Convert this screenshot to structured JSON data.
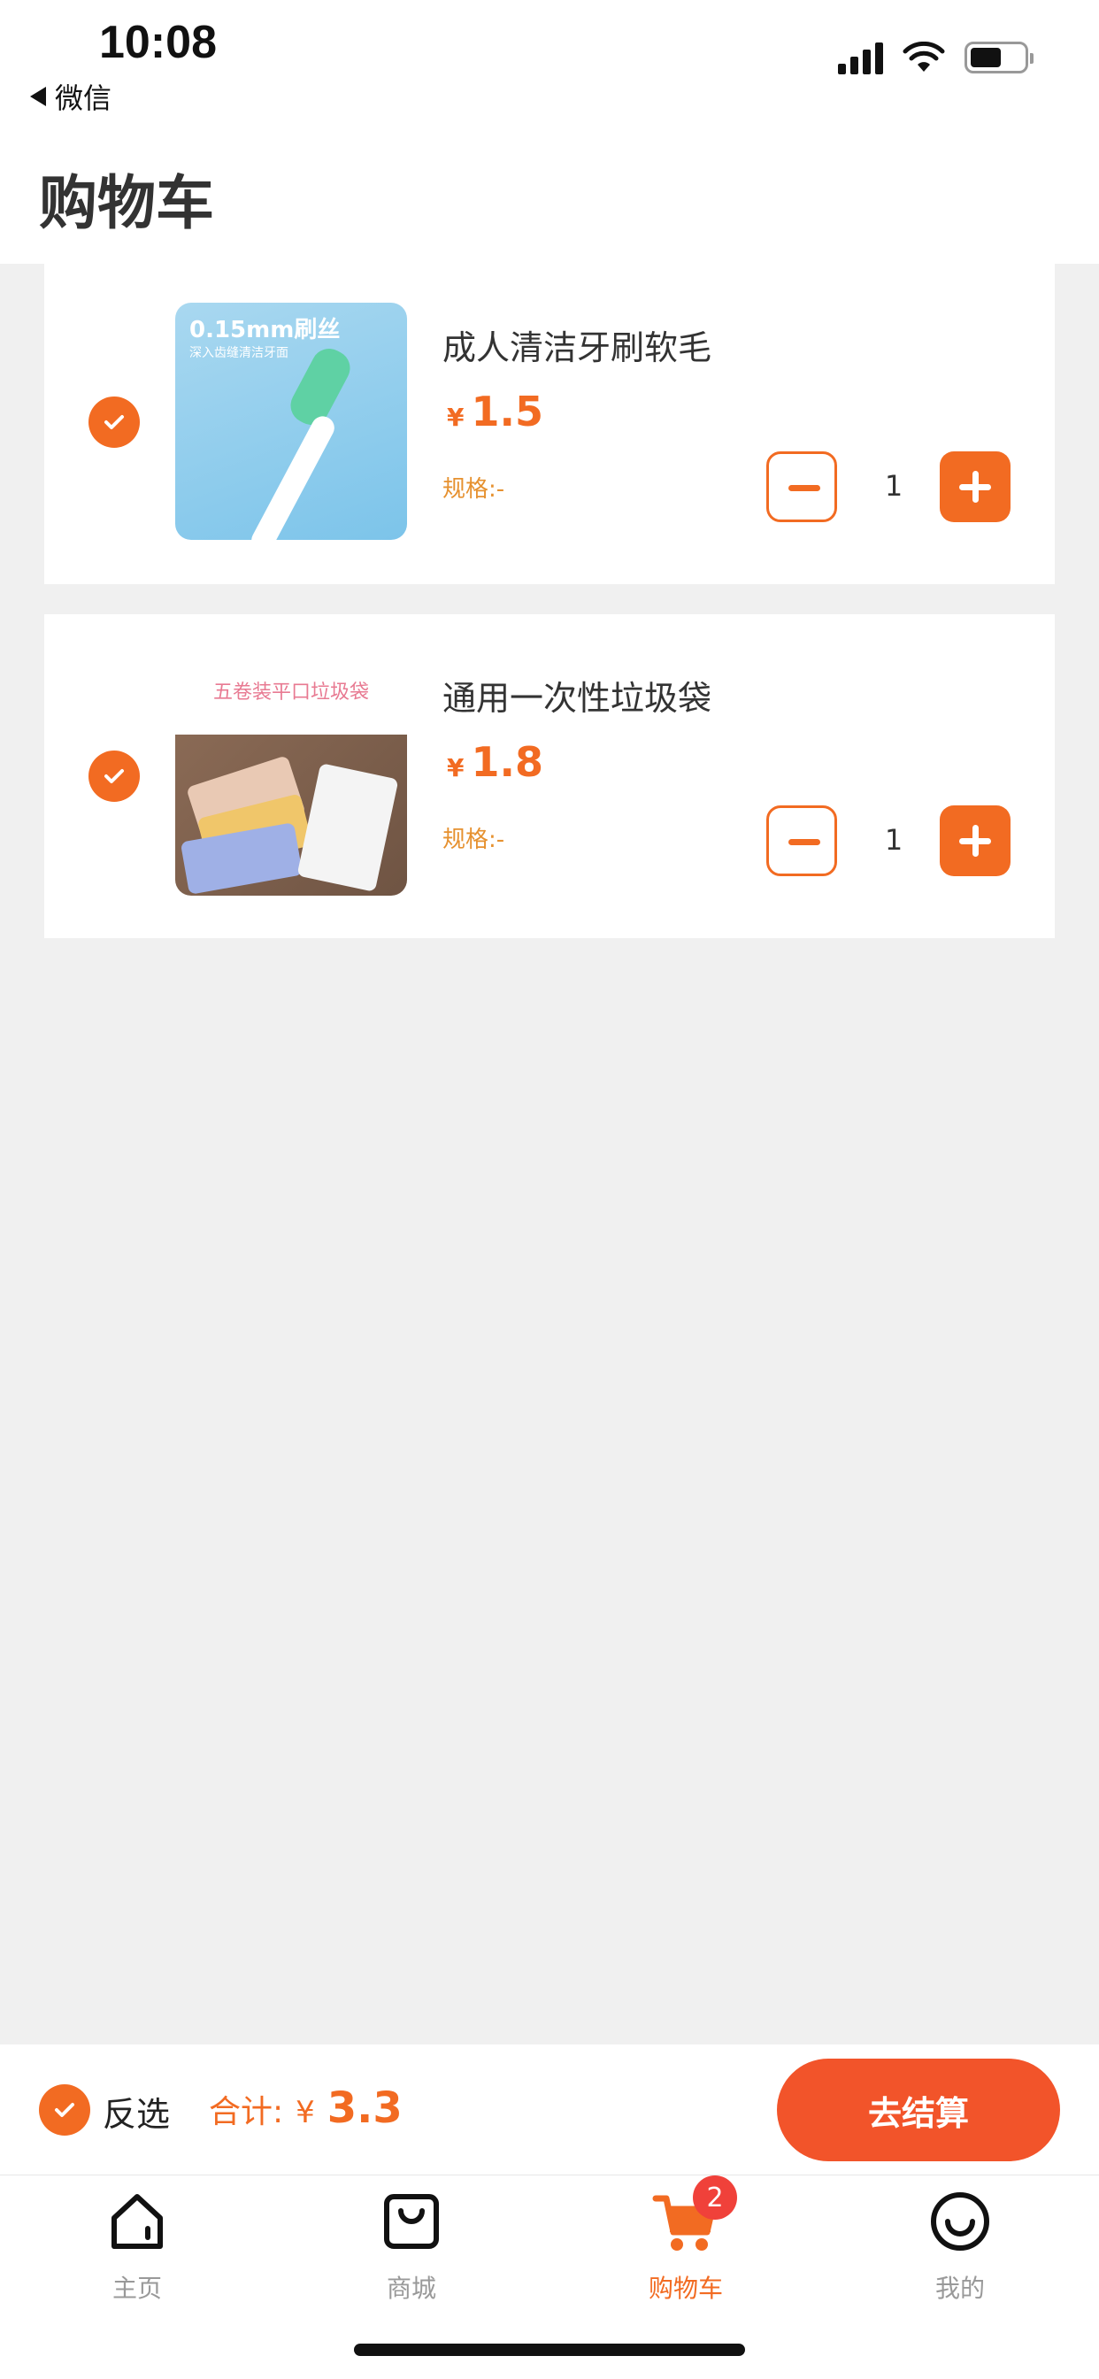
{
  "status_bar": {
    "time": "10:08",
    "back_app": "微信"
  },
  "header": {
    "title": "购物车"
  },
  "cart": {
    "items": [
      {
        "name": "成人清洁牙刷软毛",
        "currency": "¥",
        "price": "1.5",
        "spec": "规格:-",
        "quantity": "1",
        "thumb_title": "0.15mm刷丝",
        "thumb_sub": "深入齿缝清洁牙面",
        "checked": true
      },
      {
        "name": "通用一次性垃圾袋",
        "currency": "¥",
        "price": "1.8",
        "spec": "规格:-",
        "quantity": "1",
        "thumb_title": "五卷装平口垃圾袋",
        "checked": true
      }
    ]
  },
  "checkout": {
    "invert_label": "反选",
    "total_label": "合计:",
    "currency": "¥",
    "total": "3.3",
    "pay_label": "去结算"
  },
  "tabbar": {
    "tabs": [
      {
        "label": "主页",
        "icon": "home-icon"
      },
      {
        "label": "商城",
        "icon": "shopping-bag-icon"
      },
      {
        "label": "购物车",
        "icon": "cart-icon",
        "badge": "2",
        "active": true
      },
      {
        "label": "我的",
        "icon": "smile-icon"
      }
    ]
  },
  "colors": {
    "accent": "#f26b22",
    "pay_button": "#f2542a",
    "badge": "#f0413a",
    "background": "#f0f0f0"
  }
}
